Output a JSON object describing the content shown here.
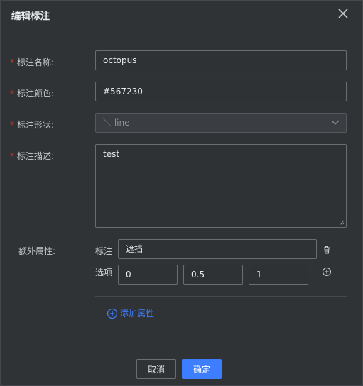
{
  "dialog": {
    "title": "编辑标注",
    "required_mark": "*"
  },
  "form": {
    "name": {
      "label": "标注名称:",
      "value": "octopus"
    },
    "color": {
      "label": "标注颜色:",
      "value": "#567230"
    },
    "shape": {
      "label": "标注形状:",
      "value": "＼ line",
      "disabled": true
    },
    "description": {
      "label": "标注描述:",
      "value": "test"
    }
  },
  "extra": {
    "label": "额外属性:",
    "tag_label": "标注",
    "tag_value": "遮挡",
    "options_label": "选项",
    "options": [
      "0",
      "0.5",
      "1"
    ],
    "add_label": "添加属性"
  },
  "footer": {
    "cancel": "取消",
    "ok": "确定"
  },
  "colors": {
    "accent": "#3d7eff",
    "required": "#c0392b",
    "background": "#303336"
  }
}
